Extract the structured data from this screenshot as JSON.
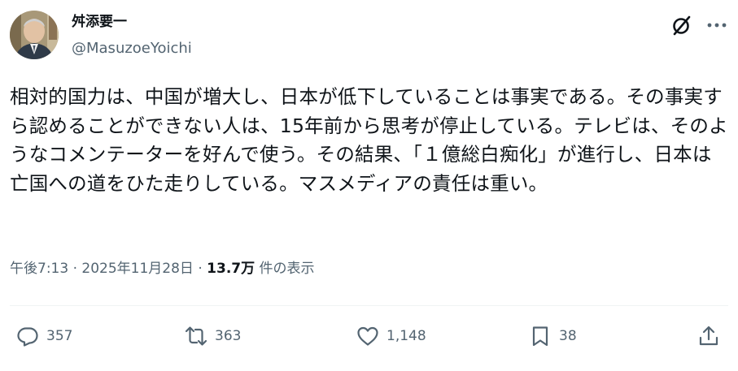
{
  "author": {
    "name": "舛添要一",
    "handle": "@MasuzoeYoichi"
  },
  "header_icons": {
    "grok": "grok-icon",
    "more": "more-icon"
  },
  "tweet": {
    "text": "相対的国力は、中国が増大し、日本が低下していることは事実である。その事実すら認めることができない人は、15年前から思考が停止している。テレビは、そのようなコメンテーターを好んで使う。その結果、「１億総白痴化」が進行し、日本は亡国への道をひた走りしている。マスメディアの責任は重い。"
  },
  "meta": {
    "time": "午後7:13",
    "separator": " · ",
    "date": "2025年11月28日",
    "views_count": "13.7万",
    "views_label": " 件の表示"
  },
  "actions": {
    "replies": "357",
    "reposts": "363",
    "likes": "1,148",
    "bookmarks": "38"
  },
  "colors": {
    "text": "#0f1419",
    "secondary": "#536471",
    "divider": "#eff3f4"
  }
}
